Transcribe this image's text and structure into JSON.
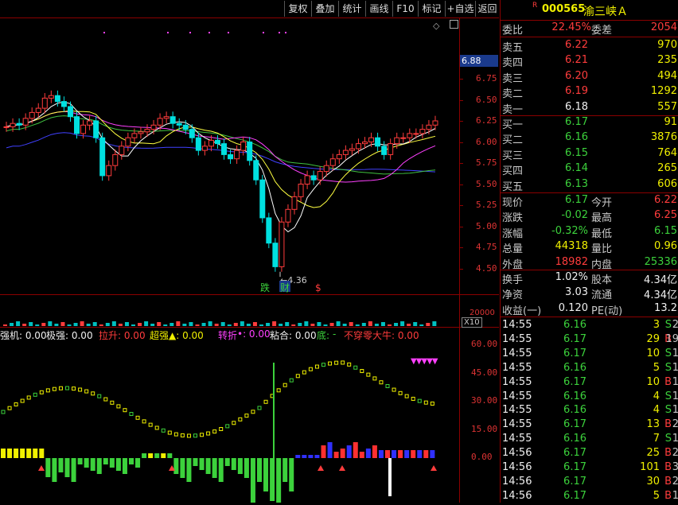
{
  "toolbar": {
    "items": [
      "复权",
      "叠加",
      "统计",
      "画线",
      "F10",
      "标记",
      "+自选",
      "返回"
    ]
  },
  "stock": {
    "badge": "R",
    "code": "000565",
    "name": "渝三峡Ａ"
  },
  "price_axis": {
    "current_tag": "6.88",
    "ticks": [
      "6.75",
      "6.50",
      "6.25",
      "6.00",
      "5.75",
      "5.50",
      "5.25",
      "5.00",
      "4.75",
      "4.50"
    ]
  },
  "main_chart": {
    "marker_low": "4.36",
    "tags": [
      "跌",
      "财",
      "$"
    ],
    "colors": {
      "up": "#ff3c3c",
      "down": "#00e0e0",
      "ma5": "#ffffff",
      "ma10": "#ffff40",
      "ma20": "#ff40ff",
      "ma60": "#40c040",
      "ma120": "#4040ff"
    }
  },
  "volume": {
    "axis": "20000",
    "unit": "X10"
  },
  "indicator": {
    "labels": [
      {
        "text": "强机: 0.00",
        "color": "#f0f0f0"
      },
      {
        "text": "极强: 0.00",
        "color": "#f0f0f0"
      },
      {
        "text": "拉升: 0.00",
        "color": "#ff3c3c"
      },
      {
        "text": "超强▲: 0.00",
        "color": "#f0f000"
      },
      {
        "text": "转折",
        "color": "#ff40ff"
      },
      {
        "text": "•: 0.00",
        "color": "#ff40ff"
      },
      {
        "text": "粘合: 0.00",
        "color": "#f0f0f0"
      },
      {
        "text": "底:",
        "color": "#3cd23c"
      },
      {
        "text": "-",
        "color": "#3cd23c"
      },
      {
        "text": "不穿零大牛: 0.00",
        "color": "#ff3c3c"
      }
    ],
    "axis": [
      "60.00",
      "45.00",
      "30.00",
      "15.00",
      "0.00"
    ],
    "triangles": "▼▼▼▼▼"
  },
  "quote": {
    "weibi_label": "委比",
    "weibi_value": "22.45%",
    "weicha_label": "委差",
    "weicha_value": "2054",
    "asks": [
      {
        "label": "卖五",
        "price": "6.22",
        "vol": "970"
      },
      {
        "label": "卖四",
        "price": "6.21",
        "vol": "235"
      },
      {
        "label": "卖三",
        "price": "6.20",
        "vol": "494"
      },
      {
        "label": "卖二",
        "price": "6.19",
        "vol": "1292"
      },
      {
        "label": "卖一",
        "price": "6.18",
        "vol": "557"
      }
    ],
    "bids": [
      {
        "label": "买一",
        "price": "6.17",
        "vol": "91"
      },
      {
        "label": "买二",
        "price": "6.16",
        "vol": "3876"
      },
      {
        "label": "买三",
        "price": "6.15",
        "vol": "764"
      },
      {
        "label": "买四",
        "price": "6.14",
        "vol": "265"
      },
      {
        "label": "买五",
        "price": "6.13",
        "vol": "606"
      }
    ],
    "stats": [
      {
        "l1": "现价",
        "v1": "6.17",
        "c1": "green",
        "l2": "今开",
        "v2": "6.22",
        "c2": "red"
      },
      {
        "l1": "涨跌",
        "v1": "-0.02",
        "c1": "green",
        "l2": "最高",
        "v2": "6.25",
        "c2": "red"
      },
      {
        "l1": "涨幅",
        "v1": "-0.32%",
        "c1": "green",
        "l2": "最低",
        "v2": "6.15",
        "c2": "green"
      },
      {
        "l1": "总量",
        "v1": "44318",
        "c1": "yellow",
        "l2": "量比",
        "v2": "0.96",
        "c2": "yellow"
      },
      {
        "l1": "外盘",
        "v1": "18982",
        "c1": "red",
        "l2": "内盘",
        "v2": "25336",
        "c2": "green"
      }
    ],
    "fund": [
      {
        "l1": "换手",
        "v1": "1.02%",
        "l2": "股本",
        "v2": "4.34亿"
      },
      {
        "l1": "净资",
        "v1": "3.03",
        "l2": "流通",
        "v2": "4.34亿"
      },
      {
        "l1": "收益(一)",
        "v1": "0.120",
        "l2": "PE(动)",
        "v2": "13.2"
      }
    ]
  },
  "ticks": [
    {
      "time": "14:55",
      "price": "6.16",
      "vol": "3",
      "bs": "S",
      "n": "2"
    },
    {
      "time": "14:55",
      "price": "6.17",
      "vol": "29",
      "bs": "B",
      "n": "19"
    },
    {
      "time": "14:55",
      "price": "6.17",
      "vol": "10",
      "bs": "S",
      "n": "1"
    },
    {
      "time": "14:55",
      "price": "6.16",
      "vol": "5",
      "bs": "S",
      "n": "1"
    },
    {
      "time": "14:55",
      "price": "6.17",
      "vol": "10",
      "bs": "B",
      "n": "1"
    },
    {
      "time": "14:55",
      "price": "6.16",
      "vol": "4",
      "bs": "S",
      "n": "1"
    },
    {
      "time": "14:55",
      "price": "6.16",
      "vol": "4",
      "bs": "S",
      "n": "1"
    },
    {
      "time": "14:55",
      "price": "6.17",
      "vol": "13",
      "bs": "B",
      "n": "2"
    },
    {
      "time": "14:55",
      "price": "6.16",
      "vol": "7",
      "bs": "S",
      "n": "1"
    },
    {
      "time": "14:56",
      "price": "6.17",
      "vol": "25",
      "bs": "B",
      "n": "2"
    },
    {
      "time": "14:56",
      "price": "6.17",
      "vol": "101",
      "bs": "B",
      "n": "3"
    },
    {
      "time": "14:56",
      "price": "6.17",
      "vol": "30",
      "bs": "B",
      "n": "2"
    },
    {
      "time": "14:56",
      "price": "6.17",
      "vol": "5",
      "bs": "B",
      "n": "1"
    }
  ]
}
